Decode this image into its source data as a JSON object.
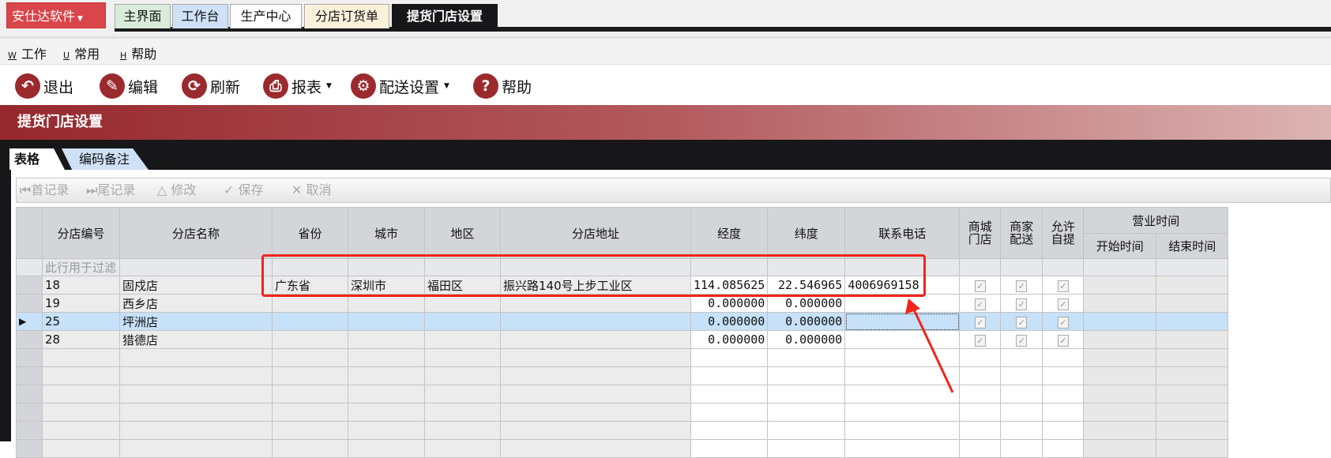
{
  "app": {
    "logo": "安仕达软件",
    "tabs": [
      "主界面",
      "工作台",
      "生产中心",
      "分店订货单",
      "提货门店设置"
    ],
    "active_tab": "提货门店设置"
  },
  "menu": [
    {
      "key": "W",
      "label": "工作"
    },
    {
      "key": "U",
      "label": "常用"
    },
    {
      "key": "H",
      "label": "帮助"
    }
  ],
  "toolbar": {
    "exit": "退出",
    "edit": "编辑",
    "refresh": "刷新",
    "report": "报表",
    "delivery": "配送设置",
    "help": "帮助"
  },
  "page_title": "提货门店设置",
  "subtabs": [
    "表格",
    "编码备注"
  ],
  "nav": {
    "first": "首记录",
    "last": "尾记录",
    "modify": "修改",
    "save": "保存",
    "cancel": "取消"
  },
  "grid": {
    "headers": [
      "分店编号",
      "分店名称",
      "省份",
      "城市",
      "地区",
      "分店地址",
      "经度",
      "纬度",
      "联系电话",
      "商城门店",
      "商家配送",
      "允许自提"
    ],
    "group_header": "营业时间",
    "sub_headers": [
      "开始时间",
      "结束时间"
    ],
    "filter_hint": "此行用于过滤",
    "rows": [
      {
        "id": "18",
        "name": "固戍店",
        "province": "广东省",
        "city": "深圳市",
        "district": "福田区",
        "address": "振兴路140号上步工业区",
        "lng": "114.085625",
        "lat": "22.546965",
        "phone": "4006969158",
        "mall": true,
        "delivery": true,
        "pickup": true,
        "selected": false
      },
      {
        "id": "19",
        "name": "西乡店",
        "province": "",
        "city": "",
        "district": "",
        "address": "",
        "lng": "0.000000",
        "lat": "0.000000",
        "phone": "",
        "mall": true,
        "delivery": true,
        "pickup": true,
        "selected": false
      },
      {
        "id": "25",
        "name": "坪洲店",
        "province": "",
        "city": "",
        "district": "",
        "address": "",
        "lng": "0.000000",
        "lat": "0.000000",
        "phone": "",
        "mall": true,
        "delivery": true,
        "pickup": true,
        "selected": true
      },
      {
        "id": "28",
        "name": "猎德店",
        "province": "",
        "city": "",
        "district": "",
        "address": "",
        "lng": "0.000000",
        "lat": "0.000000",
        "phone": "",
        "mall": true,
        "delivery": true,
        "pickup": true,
        "selected": false
      }
    ]
  },
  "colors": {
    "brand": "#d8454a",
    "accent": "#9b2a2e",
    "selected": "#c6e1f8",
    "annotation": "#f2241b"
  }
}
